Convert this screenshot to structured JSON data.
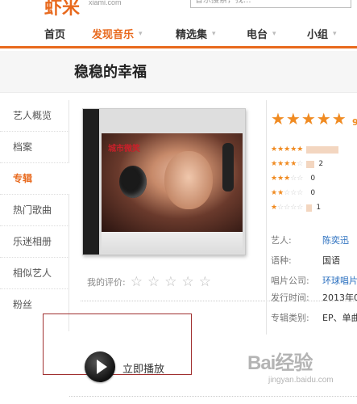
{
  "site": {
    "logo": "虾米",
    "logo_sub": "xiami.com",
    "search_placeholder": "音乐搜索，找...",
    "accent": "#e8691d"
  },
  "nav": {
    "items": [
      {
        "label": "首页"
      },
      {
        "label": "发现音乐",
        "active": true
      },
      {
        "label": "精选集"
      },
      {
        "label": "电台"
      },
      {
        "label": "小组"
      }
    ]
  },
  "page": {
    "title": "稳稳的幸福"
  },
  "sidebar": {
    "items": [
      {
        "label": "艺人概览"
      },
      {
        "label": "档案"
      },
      {
        "label": "专辑",
        "active": true
      },
      {
        "label": "热门歌曲"
      },
      {
        "label": "乐迷相册"
      },
      {
        "label": "相似艺人"
      },
      {
        "label": "粉丝"
      }
    ]
  },
  "cover": {
    "text": "城市微笑"
  },
  "my_rating": {
    "label": "我的评价:",
    "stars": 5
  },
  "score": {
    "stars": 5,
    "value": "9"
  },
  "distribution": [
    {
      "stars": 5,
      "bar": 0.6,
      "count": ""
    },
    {
      "stars": 4,
      "bar": 0.15,
      "count": "2"
    },
    {
      "stars": 3,
      "bar": 0,
      "count": "0"
    },
    {
      "stars": 2,
      "bar": 0,
      "count": "0"
    },
    {
      "stars": 1,
      "bar": 0.1,
      "count": "1"
    }
  ],
  "info": [
    {
      "key": "艺人:",
      "value": "陈奕迅",
      "link": true
    },
    {
      "key": "语种:",
      "value": "国语",
      "link": false
    },
    {
      "key": "唱片公司:",
      "value": "环球唱片",
      "link": true
    },
    {
      "key": "发行时间:",
      "value": "2013年0",
      "link": false
    },
    {
      "key": "专辑类别:",
      "value": "EP、单曲",
      "link": false
    }
  ],
  "play": {
    "label": "立即播放"
  },
  "watermark": {
    "main": "Bai经验",
    "sub": "jingyan.baidu.com"
  }
}
